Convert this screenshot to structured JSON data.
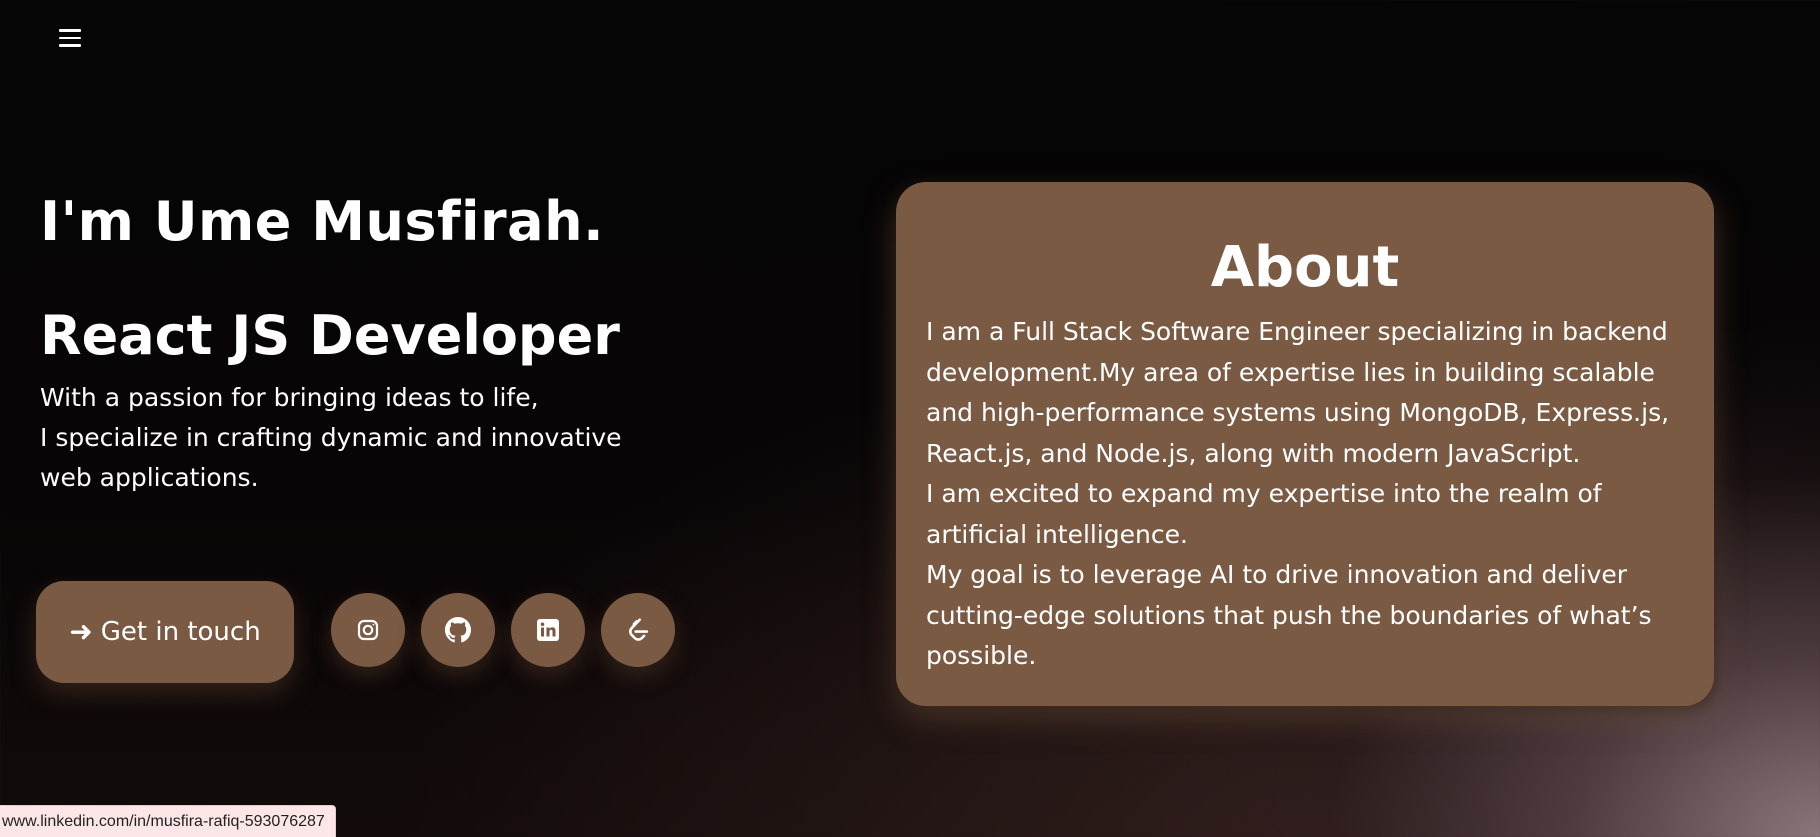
{
  "header": {
    "menu_icon": "hamburger-menu-icon"
  },
  "hero": {
    "name": "I'm Ume Musfirah.",
    "role": "React JS Developer",
    "tagline_lines": [
      "With a passion for bringing ideas to life,",
      "I specialize in crafting dynamic and innovative",
      "web applications."
    ],
    "cta_label": "Get in touch",
    "cta_icon": "arrow-right-icon"
  },
  "social_links": [
    {
      "name": "instagram",
      "icon": "instagram-icon"
    },
    {
      "name": "github",
      "icon": "github-icon"
    },
    {
      "name": "linkedin",
      "icon": "linkedin-icon"
    },
    {
      "name": "leetcode",
      "icon": "leetcode-icon"
    }
  ],
  "about": {
    "title": "About",
    "body_lines": [
      "I am a Full Stack Software Engineer specializing in backend development.My area of expertise lies in building scalable and high-performance systems using MongoDB, Express.js, React.js, and Node.js, along with modern JavaScript.",
      "I am excited to expand my expertise into the realm of artificial intelligence.",
      "My goal is to leverage AI to drive innovation and deliver cutting-edge solutions that push the boundaries of what’s possible."
    ]
  },
  "status_bar": {
    "url": "www.linkedin.com/in/musfira-rafiq-593076287"
  },
  "colors": {
    "accent": "#7b5a43",
    "background": "#050505",
    "text": "#ffffff",
    "status_bg": "#fde6e8"
  }
}
